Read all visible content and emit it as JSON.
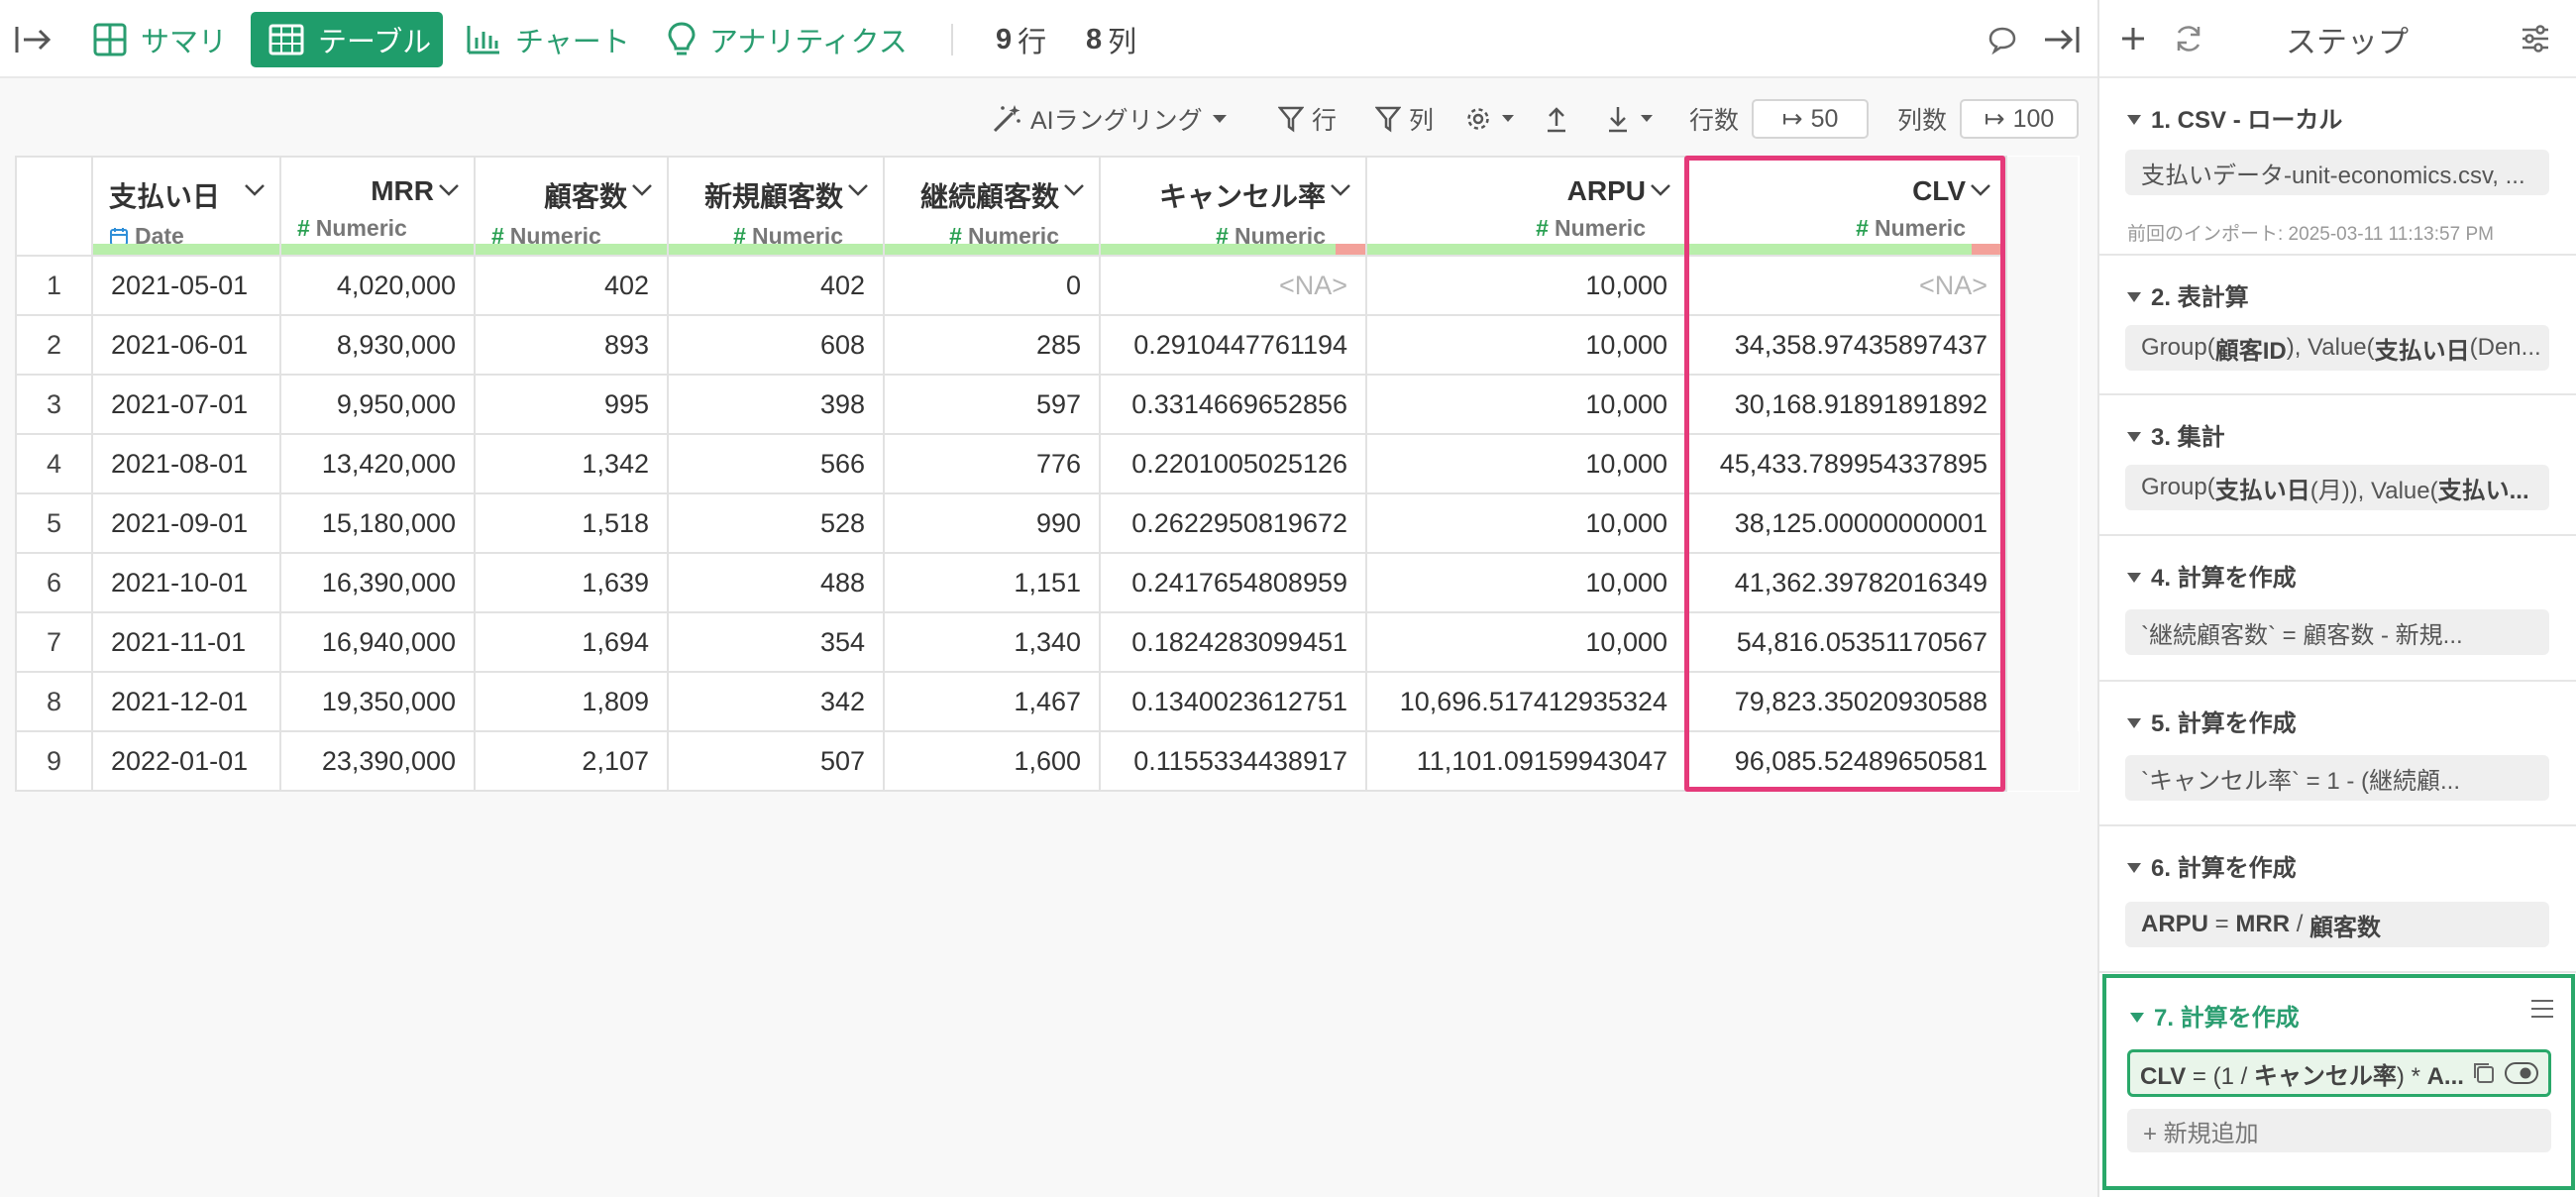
{
  "topbar": {
    "tabs": {
      "summary": "サマリ",
      "table": "テーブル",
      "chart": "チャート",
      "analytics": "アナリティクス"
    },
    "rows_count": "9",
    "rows_unit": "行",
    "cols_count": "8",
    "cols_unit": "列"
  },
  "toolbar": {
    "ai_wrangling": "AIラングリング",
    "filter_rows": "行",
    "filter_cols": "列",
    "rows_label": "行数",
    "rows_value": "50",
    "cols_label": "列数",
    "cols_value": "100"
  },
  "table": {
    "columns": [
      {
        "name": "支払い日",
        "type": "Date"
      },
      {
        "name": "MRR",
        "type": "Numeric"
      },
      {
        "name": "顧客数",
        "type": "Numeric"
      },
      {
        "name": "新規顧客数",
        "type": "Numeric"
      },
      {
        "name": "継続顧客数",
        "type": "Numeric"
      },
      {
        "name": "キャンセル率",
        "type": "Numeric"
      },
      {
        "name": "ARPU",
        "type": "Numeric"
      },
      {
        "name": "CLV",
        "type": "Numeric"
      }
    ],
    "rows": [
      [
        "1",
        "2021-05-01",
        "4,020,000",
        "402",
        "402",
        "0",
        "<NA>",
        "10,000",
        "<NA>"
      ],
      [
        "2",
        "2021-06-01",
        "8,930,000",
        "893",
        "608",
        "285",
        "0.2910447761194",
        "10,000",
        "34,358.97435897437"
      ],
      [
        "3",
        "2021-07-01",
        "9,950,000",
        "995",
        "398",
        "597",
        "0.3314669652856",
        "10,000",
        "30,168.91891891892"
      ],
      [
        "4",
        "2021-08-01",
        "13,420,000",
        "1,342",
        "566",
        "776",
        "0.2201005025126",
        "10,000",
        "45,433.789954337895"
      ],
      [
        "5",
        "2021-09-01",
        "15,180,000",
        "1,518",
        "528",
        "990",
        "0.2622950819672",
        "10,000",
        "38,125.00000000001"
      ],
      [
        "6",
        "2021-10-01",
        "16,390,000",
        "1,639",
        "488",
        "1,151",
        "0.2417654808959",
        "10,000",
        "41,362.39782016349"
      ],
      [
        "7",
        "2021-11-01",
        "16,940,000",
        "1,694",
        "354",
        "1,340",
        "0.1824283099451",
        "10,000",
        "54,816.05351170567"
      ],
      [
        "8",
        "2021-12-01",
        "19,350,000",
        "1,809",
        "342",
        "1,467",
        "0.1340023612751",
        "10,696.517412935324",
        "79,823.35020930588"
      ],
      [
        "9",
        "2022-01-01",
        "23,390,000",
        "2,107",
        "507",
        "1,600",
        "0.1155334438917",
        "11,101.09159943047",
        "96,085.52489650581"
      ]
    ]
  },
  "steps_panel": {
    "title": "ステップ",
    "steps": [
      {
        "title": "1. CSV - ローカル",
        "detail": "支払いデータ-unit-economics.csv, ...",
        "meta": "前回のインポート: 2025-03-11 11:13:57 PM"
      },
      {
        "title": "2. 表計算",
        "detail_parts": [
          "Group(",
          "顧客ID",
          "), Value(",
          "支払い日",
          " (Den..."
        ]
      },
      {
        "title": "3. 集計",
        "detail_parts": [
          "Group(",
          "支払い日",
          " (月)), Value(",
          "支払い..."
        ]
      },
      {
        "title": "4. 計算を作成",
        "detail_parts": [
          "`継続顧客数` = 顧客数 - 新規..."
        ]
      },
      {
        "title": "5. 計算を作成",
        "detail_parts": [
          "`キャンセル率` = 1 - (継続顧..."
        ]
      },
      {
        "title": "6. 計算を作成",
        "detail_parts": [
          "ARPU",
          " = ",
          "MRR",
          " / ",
          "顧客数"
        ]
      },
      {
        "title": "7. 計算を作成",
        "formula_parts": [
          "CLV",
          " = (1 / ",
          "キャンセル率",
          ") * ",
          "A..."
        ],
        "add_label": "+ 新規追加"
      }
    ]
  },
  "colors": {
    "accent_green": "#1f9d6b",
    "highlight_pink": "#e53a7a",
    "quality_good": "#b8eeaa",
    "quality_bad": "#f3a19a"
  },
  "icons": [
    "collapse-left-icon",
    "grid-icon",
    "table-icon",
    "bar-chart-icon",
    "lightbulb-icon",
    "comment-icon",
    "expand-right-icon",
    "magic-wand-icon",
    "filter-icon",
    "gear-icon",
    "upload-icon",
    "download-icon",
    "plus-icon",
    "refresh-icon",
    "settings-sliders-icon",
    "copy-icon",
    "eye-icon",
    "menu-icon",
    "chevron-down-icon",
    "calendar-icon"
  ]
}
